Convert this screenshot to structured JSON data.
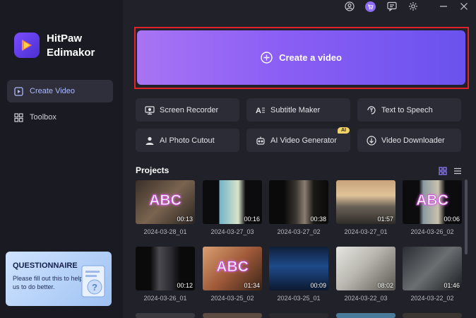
{
  "app": {
    "name_line1": "HitPaw",
    "name_line2": "Edimakor"
  },
  "topbar": {
    "icons": [
      "user-icon",
      "cart-icon",
      "message-icon",
      "settings-icon",
      "minimize-icon",
      "close-icon"
    ]
  },
  "sidebar": {
    "items": [
      {
        "label": "Create Video",
        "icon": "play-square-icon",
        "active": true
      },
      {
        "label": "Toolbox",
        "icon": "grid-icon",
        "active": false
      }
    ],
    "questionnaire": {
      "title": "QUESTIONNAIRE",
      "text": "Please fill out this to help us to do better."
    }
  },
  "create": {
    "label": "Create a video"
  },
  "tools": [
    {
      "label": "Screen Recorder",
      "icon": "screen-recorder-icon"
    },
    {
      "label": "Subtitle Maker",
      "icon": "subtitle-icon"
    },
    {
      "label": "Text to Speech",
      "icon": "text-to-speech-icon"
    },
    {
      "label": "AI Photo Cutout",
      "icon": "photo-cutout-icon"
    },
    {
      "label": "AI Video Generator",
      "icon": "ai-generator-icon",
      "badge": "AI"
    },
    {
      "label": "Video Downloader",
      "icon": "download-icon"
    }
  ],
  "projects": {
    "title": "Projects",
    "items": [
      {
        "name": "2024-03-28_01",
        "duration": "00:13",
        "overlay": "ABC"
      },
      {
        "name": "2024-03-27_03",
        "duration": "00:16",
        "overlay": ""
      },
      {
        "name": "2024-03-27_02",
        "duration": "00:38",
        "overlay": ""
      },
      {
        "name": "2024-03-27_01",
        "duration": "01:57",
        "overlay": ""
      },
      {
        "name": "2024-03-26_02",
        "duration": "00:06",
        "overlay": "ABC"
      },
      {
        "name": "2024-03-26_01",
        "duration": "00:12",
        "overlay": ""
      },
      {
        "name": "2024-03-25_02",
        "duration": "01:34",
        "overlay": "ABC"
      },
      {
        "name": "2024-03-25_01",
        "duration": "00:09",
        "overlay": ""
      },
      {
        "name": "2024-03-22_03",
        "duration": "08:02",
        "overlay": ""
      },
      {
        "name": "2024-03-22_02",
        "duration": "01:46",
        "overlay": ""
      }
    ]
  },
  "colors": {
    "accent": "#8a5ef5",
    "highlight_border": "#e0242a",
    "background": "#202129",
    "sidebar": "#1a1b22"
  }
}
